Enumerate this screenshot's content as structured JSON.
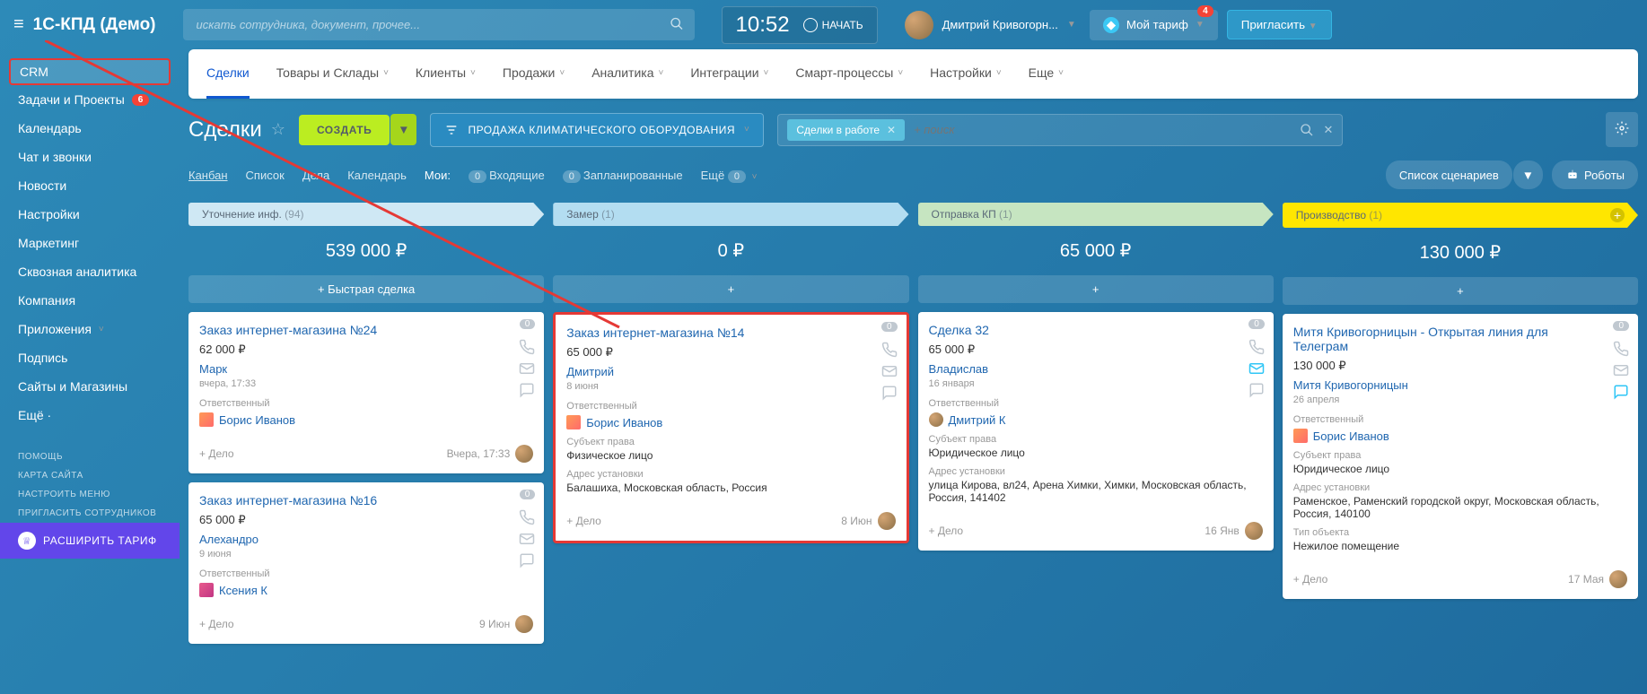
{
  "header": {
    "logo": "1С-КПД (Демо)",
    "search_placeholder": "искать сотрудника, документ, прочее...",
    "time": "10:52",
    "start_label": "НАЧАТЬ",
    "user_name": "Дмитрий Кривогорн...",
    "tariff_label": "Мой тариф",
    "tariff_badge": "4",
    "invite_label": "Пригласить"
  },
  "sidebar": {
    "items": [
      {
        "label": "CRM",
        "active": true
      },
      {
        "label": "Задачи и Проекты",
        "badge": "6"
      },
      {
        "label": "Календарь"
      },
      {
        "label": "Чат и звонки"
      },
      {
        "label": "Новости"
      },
      {
        "label": "Настройки"
      },
      {
        "label": "Маркетинг"
      },
      {
        "label": "Сквозная аналитика"
      },
      {
        "label": "Компания"
      },
      {
        "label": "Приложения",
        "dropdown": true
      },
      {
        "label": "Подпись"
      },
      {
        "label": "Сайты и Магазины"
      },
      {
        "label": "Ещё ·"
      }
    ],
    "footer": [
      {
        "label": "ПОМОЩЬ"
      },
      {
        "label": "КАРТА САЙТА"
      },
      {
        "label": "НАСТРОИТЬ МЕНЮ"
      },
      {
        "label": "ПРИГЛАСИТЬ СОТРУДНИКОВ"
      }
    ],
    "expand": "РАСШИРИТЬ ТАРИФ"
  },
  "tabs": [
    {
      "label": "Сделки",
      "active": true
    },
    {
      "label": "Товары и Склады",
      "dropdown": true
    },
    {
      "label": "Клиенты",
      "dropdown": true
    },
    {
      "label": "Продажи",
      "dropdown": true
    },
    {
      "label": "Аналитика",
      "dropdown": true
    },
    {
      "label": "Интеграции",
      "dropdown": true
    },
    {
      "label": "Смарт-процессы",
      "dropdown": true
    },
    {
      "label": "Настройки",
      "dropdown": true
    },
    {
      "label": "Еще",
      "dropdown": true
    }
  ],
  "toolbar": {
    "title": "Сделки",
    "create": "СОЗДАТЬ",
    "filter": "ПРОДАЖА КЛИМАТИЧЕСКОГО ОБОРУДОВАНИЯ",
    "tag": "Сделки в работе",
    "search_placeholder": "+ поиск"
  },
  "views": {
    "kanban": "Канбан",
    "list": "Список",
    "tasks": "Дела",
    "calendar": "Календарь",
    "mine": "Мои:",
    "inbox_count": "0",
    "inbox": "Входящие",
    "planned_count": "0",
    "planned": "Запланированные",
    "more": "Ещё",
    "more_count": "0",
    "scenarios": "Список сценариев",
    "robots": "Роботы"
  },
  "columns": [
    {
      "name": "Уточнение инф.",
      "count": "(94)",
      "sum": "539 000 ₽",
      "style": "blue",
      "quick": "+   Быстрая сделка",
      "cards": [
        {
          "title": "Заказ интернет-магазина №24",
          "badge": "0",
          "price": "62 000 ₽",
          "contact": "Марк",
          "date": "вчера, 17:33",
          "resp_label": "Ответственный",
          "resp_name": "Борис Иванов",
          "add": "+ Дело",
          "footer_date": "Вчера, 17:33"
        },
        {
          "title": "Заказ интернет-магазина №16",
          "badge": "0",
          "price": "65 000 ₽",
          "contact": "Алехандро",
          "date": "9 июня",
          "resp_label": "Ответственный",
          "resp_name": "Ксения К",
          "avatar_class": "female",
          "add": "+ Дело",
          "footer_date": "9 Июн"
        }
      ]
    },
    {
      "name": "Замер",
      "count": "(1)",
      "sum": "0 ₽",
      "style": "blue2",
      "quick": "+",
      "cards": [
        {
          "title": "Заказ интернет-магазина №14",
          "badge": "0",
          "price": "65 000 ₽",
          "contact": "Дмитрий",
          "date": "8 июня",
          "resp_label": "Ответственный",
          "resp_name": "Борис Иванов",
          "subject_label": "Субъект права",
          "subject": "Физическое лицо",
          "addr_label": "Адрес установки",
          "addr": "Балашиха, Московская область, Россия",
          "add": "+ Дело",
          "footer_date": "8 Июн",
          "highlighted": true
        }
      ]
    },
    {
      "name": "Отправка КП",
      "count": "(1)",
      "sum": "65 000 ₽",
      "style": "green",
      "quick": "+",
      "cards": [
        {
          "title": "Сделка 32",
          "badge": "0",
          "price": "65 000 ₽",
          "contact": "Владислав",
          "date": "16 января",
          "resp_label": "Ответственный",
          "resp_name": "Дмитрий К",
          "avatar_class": "male",
          "subject_label": "Субъект права",
          "subject": "Юридическое лицо",
          "addr_label": "Адрес установки",
          "addr": "улица Кирова, вл24, Арена Химки, Химки, Московская область, Россия, 141402",
          "add": "+ Дело",
          "footer_date": "16 Янв",
          "mail_active": true
        }
      ]
    },
    {
      "name": "Производство",
      "count": "(1)",
      "sum": "130 000 ₽",
      "style": "yellow",
      "quick": "+",
      "cards": [
        {
          "title": "Митя Кривогорницын - Открытая линия для Телеграм",
          "badge": "0",
          "price": "130 000 ₽",
          "contact": "Митя Кривогорницын",
          "date": "26 апреля",
          "resp_label": "Ответственный",
          "resp_name": "Борис Иванов",
          "subject_label": "Субъект права",
          "subject": "Юридическое лицо",
          "addr_label": "Адрес установки",
          "addr": "Раменское, Раменский городской округ, Московская область, Россия, 140100",
          "type_label": "Тип объекта",
          "type": "Нежилое помещение",
          "add": "+ Дело",
          "footer_date": "17 Мая",
          "chat_active": true
        }
      ]
    }
  ]
}
